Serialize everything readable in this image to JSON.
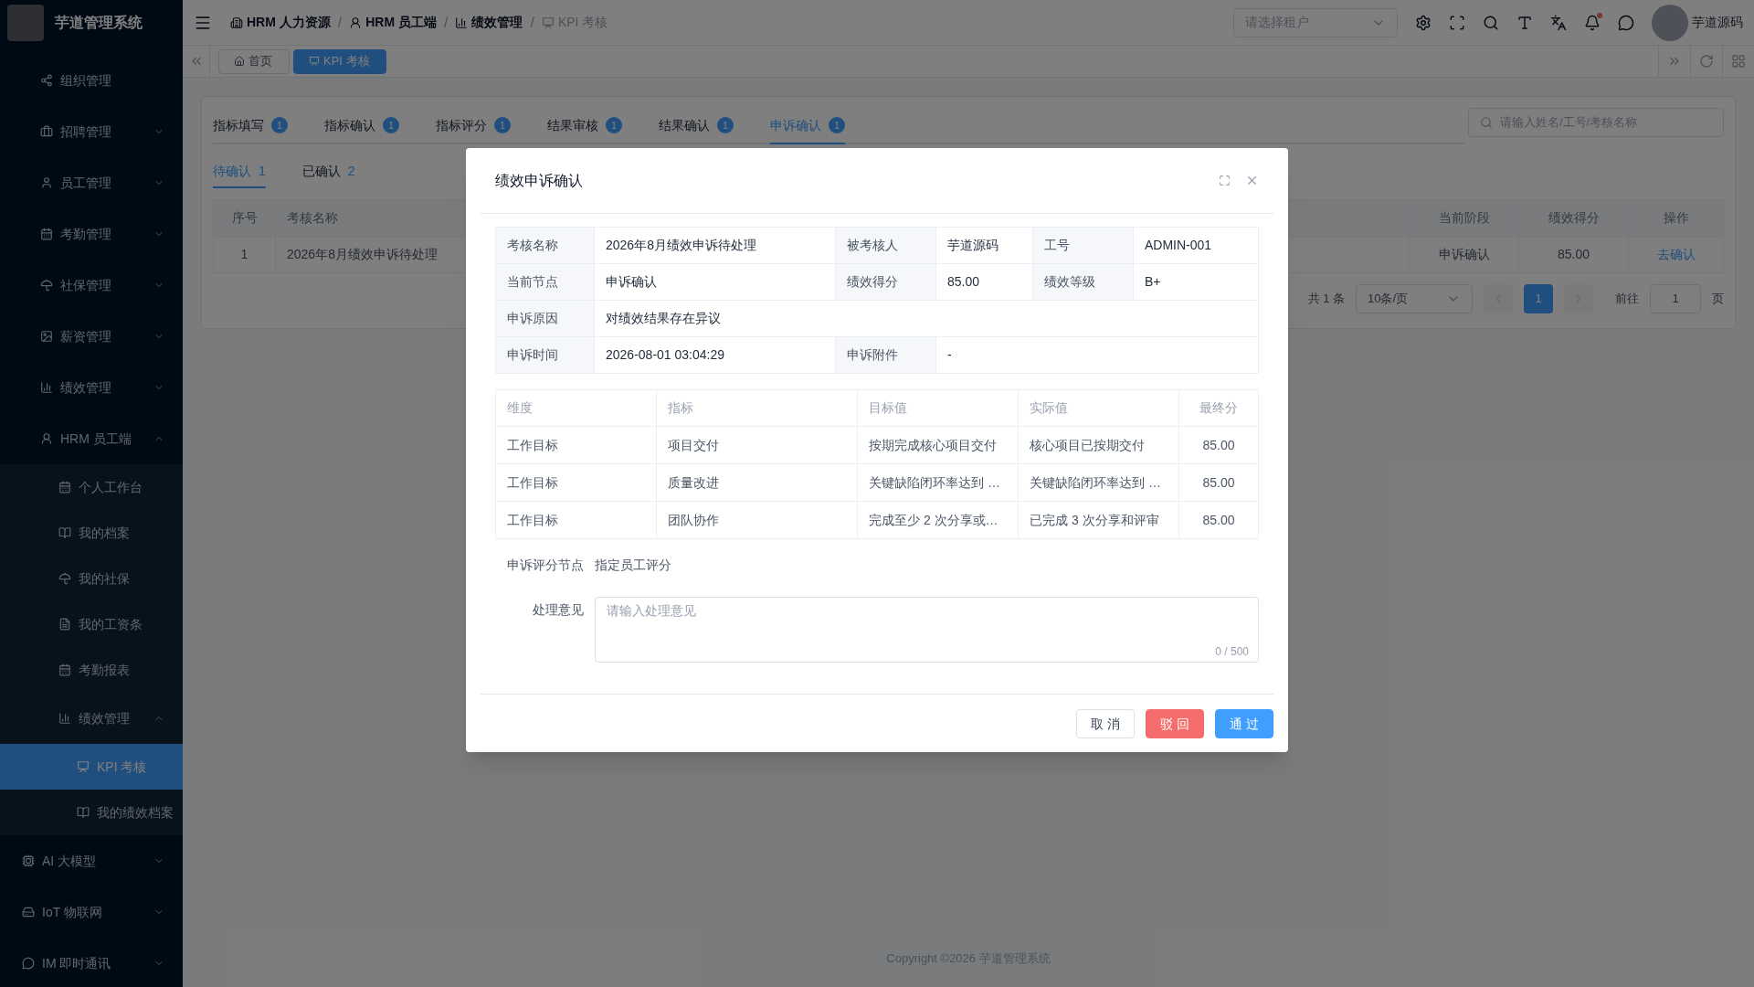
{
  "app": {
    "title": "芋道管理系统"
  },
  "sidebar": {
    "open_menu_items": [
      {
        "label": "组织管理"
      },
      {
        "label": "招聘管理",
        "expanded": false
      },
      {
        "label": "员工管理",
        "expanded": false
      },
      {
        "label": "考勤管理",
        "expanded": false
      },
      {
        "label": "社保管理",
        "expanded": false
      },
      {
        "label": "薪资管理",
        "expanded": false
      },
      {
        "label": "绩效管理",
        "expanded": false
      },
      {
        "label": "HRM 员工端",
        "expanded": true,
        "children": [
          {
            "label": "个人工作台"
          },
          {
            "label": "我的档案"
          },
          {
            "label": "我的社保"
          },
          {
            "label": "我的工资条"
          },
          {
            "label": "考勤报表"
          },
          {
            "label": "绩效管理",
            "expanded": true,
            "children": [
              {
                "label": "KPI 考核",
                "selected": true
              },
              {
                "label": "我的绩效档案",
                "selected": false
              }
            ]
          }
        ]
      }
    ],
    "items": [
      {
        "label": "AI 大模型",
        "expanded": false
      },
      {
        "label": "IoT 物联网",
        "expanded": false
      },
      {
        "label": "IM 即时通讯",
        "expanded": false
      }
    ]
  },
  "breadcrumb": [
    {
      "label": "HRM 人力资源",
      "current": false
    },
    {
      "separator": "/",
      "label": "HRM 员工端",
      "current": false
    },
    {
      "separator": "/",
      "label": "绩效管理",
      "current": false
    },
    {
      "separator": "/",
      "label": "KPI 考核",
      "current": true
    }
  ],
  "tenant_select": {
    "placeholder": "请选择租户"
  },
  "user": {
    "name": "芋道源码"
  },
  "notifications": {
    "unread": true
  },
  "page_tabs": [
    {
      "label": "首页",
      "selected": false
    },
    {
      "label": "KPI 考核",
      "selected": true
    }
  ],
  "stage_tabs": [
    {
      "label": "指标填写",
      "count": "1",
      "selected": false
    },
    {
      "label": "指标确认",
      "count": "1",
      "selected": false
    },
    {
      "label": "指标评分",
      "count": "1",
      "selected": false
    },
    {
      "label": "结果审核",
      "count": "1",
      "selected": false
    },
    {
      "label": "结果确认",
      "count": "1",
      "selected": false
    },
    {
      "label": "申诉确认",
      "count": "1",
      "selected": true
    }
  ],
  "search": {
    "placeholder": "请输入姓名/工号/考核名称"
  },
  "status_tabs": [
    {
      "label": "待确认",
      "count": "1",
      "selected": true
    },
    {
      "label": "已确认",
      "count": "2",
      "selected": false
    }
  ],
  "table": {
    "columns": [
      "序号",
      "考核名称",
      "当前阶段",
      "绩效得分",
      "操作"
    ],
    "rows": [
      {
        "cells": [
          "1",
          "2026年8月绩效申诉待处理",
          "申诉确认",
          "85.00"
        ],
        "action": "去确认"
      }
    ]
  },
  "pagination": {
    "total": "共 1 条",
    "page_size": "10条/页",
    "pages": [
      {
        "label": "1",
        "selected": true
      }
    ],
    "goto_label": "前往",
    "goto_value": "1",
    "goto_suffix": "页"
  },
  "footer": "Copyright ©2026 芋道管理系统",
  "dialog": {
    "title": "绩效申诉确认",
    "details": [
      [
        {
          "label": "考核名称",
          "value": "2026年8月绩效申诉待处理"
        },
        {
          "label": "被考核人",
          "value": "芋道源码"
        },
        {
          "label": "工号",
          "value": "ADMIN-001"
        }
      ],
      [
        {
          "label": "当前节点",
          "value": "申诉确认"
        },
        {
          "label": "绩效得分",
          "value": "85.00"
        },
        {
          "label": "绩效等级",
          "value": "B+"
        }
      ],
      [
        {
          "label": "申诉原因",
          "value": "对绩效结果存在异议"
        }
      ],
      [
        {
          "label": "申诉时间",
          "value": "2026-08-01 03:04:29"
        },
        {
          "label": "申诉附件",
          "value": "-"
        }
      ]
    ],
    "score_table": {
      "columns": [
        "维度",
        "指标",
        "目标值",
        "实际值",
        "最终分"
      ],
      "rows": [
        [
          "工作目标",
          "项目交付",
          "按期完成核心项目交付",
          "核心项目已按期交付",
          "85.00"
        ],
        [
          "工作目标",
          "质量改进",
          "关键缺陷闭环率达到 …",
          "关键缺陷闭环率达到 …",
          "85.00"
        ],
        [
          "工作目标",
          "团队协作",
          "完成至少 2 次分享或…",
          "已完成 3 次分享和评审",
          "85.00"
        ]
      ]
    },
    "appeal_node": {
      "label": "申诉评分节点",
      "value": "指定员工评分"
    },
    "opinion": {
      "label": "处理意见",
      "placeholder": "请输入处理意见",
      "counter": "0 / 500"
    },
    "buttons": [
      {
        "label": "取 消",
        "kind": "default"
      },
      {
        "label": "驳 回",
        "kind": "danger"
      },
      {
        "label": "通 过",
        "kind": "primary"
      }
    ]
  }
}
